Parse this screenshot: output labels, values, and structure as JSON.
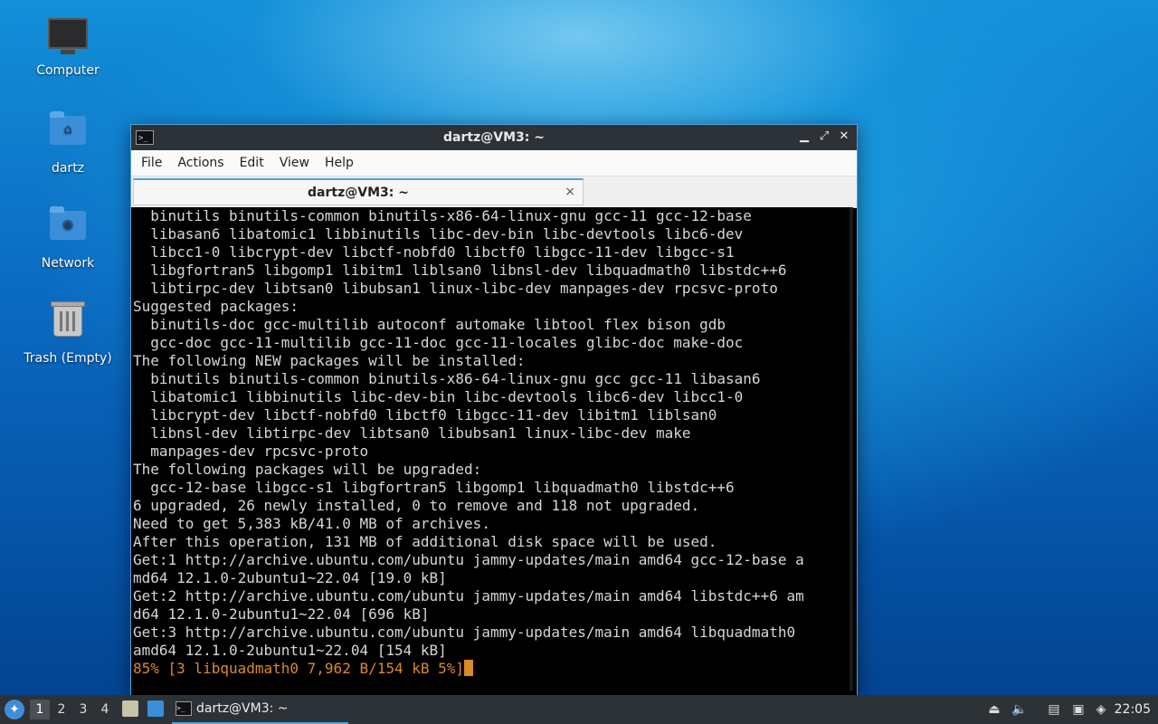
{
  "desktop": {
    "icons": [
      {
        "label": "Computer",
        "icon": "computer-icon"
      },
      {
        "label": "dartz",
        "icon": "home-folder-icon"
      },
      {
        "label": "Network",
        "icon": "network-folder-icon"
      },
      {
        "label": "Trash (Empty)",
        "icon": "trash-icon"
      }
    ]
  },
  "window": {
    "title": "dartz@VM3: ~",
    "menu": [
      "File",
      "Actions",
      "Edit",
      "View",
      "Help"
    ],
    "tab": {
      "label": "dartz@VM3: ~",
      "close": "×"
    },
    "terminal_lines": [
      "  binutils binutils-common binutils-x86-64-linux-gnu gcc-11 gcc-12-base",
      "  libasan6 libatomic1 libbinutils libc-dev-bin libc-devtools libc6-dev",
      "  libcc1-0 libcrypt-dev libctf-nobfd0 libctf0 libgcc-11-dev libgcc-s1",
      "  libgfortran5 libgomp1 libitm1 liblsan0 libnsl-dev libquadmath0 libstdc++6",
      "  libtirpc-dev libtsan0 libubsan1 linux-libc-dev manpages-dev rpcsvc-proto",
      "Suggested packages:",
      "  binutils-doc gcc-multilib autoconf automake libtool flex bison gdb",
      "  gcc-doc gcc-11-multilib gcc-11-doc gcc-11-locales glibc-doc make-doc",
      "The following NEW packages will be installed:",
      "  binutils binutils-common binutils-x86-64-linux-gnu gcc gcc-11 libasan6",
      "  libatomic1 libbinutils libc-dev-bin libc-devtools libc6-dev libcc1-0",
      "  libcrypt-dev libctf-nobfd0 libctf0 libgcc-11-dev libitm1 liblsan0",
      "  libnsl-dev libtirpc-dev libtsan0 libubsan1 linux-libc-dev make",
      "  manpages-dev rpcsvc-proto",
      "The following packages will be upgraded:",
      "  gcc-12-base libgcc-s1 libgfortran5 libgomp1 libquadmath0 libstdc++6",
      "6 upgraded, 26 newly installed, 0 to remove and 118 not upgraded.",
      "Need to get 5,383 kB/41.0 MB of archives.",
      "After this operation, 131 MB of additional disk space will be used.",
      "Get:1 http://archive.ubuntu.com/ubuntu jammy-updates/main amd64 gcc-12-base a",
      "md64 12.1.0-2ubuntu1~22.04 [19.0 kB]",
      "Get:2 http://archive.ubuntu.com/ubuntu jammy-updates/main amd64 libstdc++6 am",
      "d64 12.1.0-2ubuntu1~22.04 [696 kB]",
      "Get:3 http://archive.ubuntu.com/ubuntu jammy-updates/main amd64 libquadmath0",
      "amd64 12.1.0-2ubuntu1~22.04 [154 kB]"
    ],
    "progress_line": "85% [3 libquadmath0 7,962 B/154 kB 5%]"
  },
  "taskbar": {
    "workspaces": [
      "1",
      "2",
      "3",
      "4"
    ],
    "active_workspace": "1",
    "task_label": "dartz@VM3: ~",
    "clock": "22:05"
  },
  "colors": {
    "accent": "#4da3e0",
    "progress": "#d98a2b",
    "terminal_bg": "#000000",
    "titlebar": "#2d3237"
  }
}
